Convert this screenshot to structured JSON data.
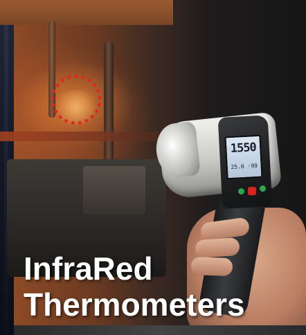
{
  "overlay": {
    "title_line1": "InfraRed",
    "title_line2": "Thermometers"
  },
  "device_display": {
    "main_reading": "1550",
    "sub_reading": "25.0 ·99"
  },
  "colors": {
    "title_text": "#ffffff",
    "target_circle": "#e2261e",
    "button_red": "#d8241e",
    "button_green": "#2fa64a"
  }
}
